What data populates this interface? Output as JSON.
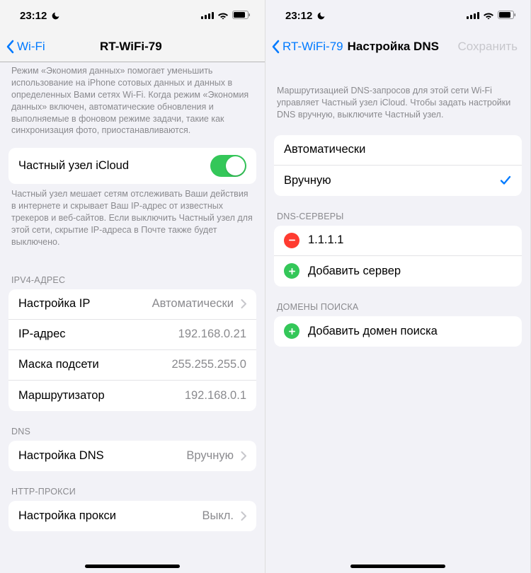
{
  "statusbar": {
    "time": "23:12"
  },
  "left": {
    "nav": {
      "back": "Wi-Fi",
      "title": "RT-WiFi-79"
    },
    "dataSavingFooter": "Режим «Экономия данных» помогает уменьшить использование на iPhone сотовых данных и данных в определенных Вами сетях Wi-Fi. Когда режим «Экономия данных» включен, автоматические обновления и выполняемые в фоновом режиме задачи, такие как синхронизация фото, приостанавливаются.",
    "privateRelay": {
      "label": "Частный узел iCloud"
    },
    "privateRelayFooter": "Частный узел мешает сетям отслеживать Ваши действия в интернете и скрывает Ваш IP-адрес от известных трекеров и веб-сайтов. Если выключить Частный узел для этой сети, скрытие IP-адреса в Почте также будет выключено.",
    "ipv4": {
      "header": "IPV4-АДРЕС",
      "configure": {
        "label": "Настройка IP",
        "value": "Автоматически"
      },
      "ip": {
        "label": "IP-адрес",
        "value": "192.168.0.21"
      },
      "subnet": {
        "label": "Маска подсети",
        "value": "255.255.255.0"
      },
      "router": {
        "label": "Маршрутизатор",
        "value": "192.168.0.1"
      }
    },
    "dns": {
      "header": "DNS",
      "configure": {
        "label": "Настройка DNS",
        "value": "Вручную"
      }
    },
    "proxy": {
      "header": "HTTP-ПРОКСИ",
      "configure": {
        "label": "Настройка прокси",
        "value": "Выкл."
      }
    }
  },
  "right": {
    "nav": {
      "back": "RT-WiFi-79",
      "title": "Настройка DNS",
      "save": "Сохранить"
    },
    "intro": "Маршрутизацией DNS-запросов для этой сети Wi-Fi управляет Частный узел iCloud. Чтобы задать настройки DNS вручную, выключите Частный узел.",
    "mode": {
      "auto": "Автоматически",
      "manual": "Вручную"
    },
    "servers": {
      "header": "DNS-СЕРВЕРЫ",
      "entry": "1.1.1.1",
      "add": "Добавить сервер"
    },
    "searchDomains": {
      "header": "ДОМЕНЫ ПОИСКА",
      "add": "Добавить домен поиска"
    }
  }
}
